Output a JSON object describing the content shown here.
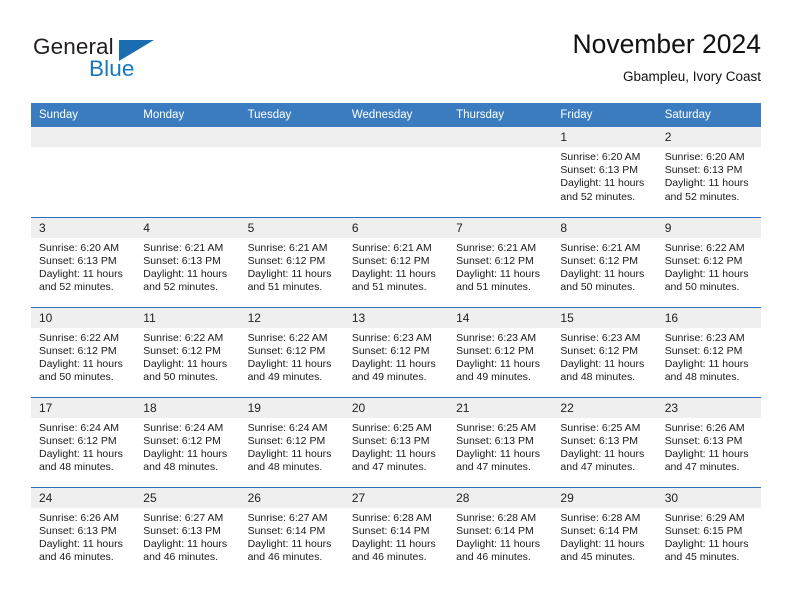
{
  "brand": {
    "name_part1": "General",
    "name_part2": "Blue",
    "triangle_color": "#1b6cb0",
    "blue_text_color": "#1878be"
  },
  "header": {
    "title": "November 2024",
    "subtitle": "Gbampleu, Ivory Coast"
  },
  "theme": {
    "header_blue": "#3b7cc0",
    "row_divider_blue": "#2f6fb5",
    "daynum_gray": "#efefef"
  },
  "weekday_headers": [
    "Sunday",
    "Monday",
    "Tuesday",
    "Wednesday",
    "Thursday",
    "Friday",
    "Saturday"
  ],
  "weeks": [
    [
      {
        "day": "",
        "lines": []
      },
      {
        "day": "",
        "lines": []
      },
      {
        "day": "",
        "lines": []
      },
      {
        "day": "",
        "lines": []
      },
      {
        "day": "",
        "lines": []
      },
      {
        "day": "1",
        "lines": [
          "Sunrise: 6:20 AM",
          "Sunset: 6:13 PM",
          "Daylight: 11 hours and 52 minutes."
        ]
      },
      {
        "day": "2",
        "lines": [
          "Sunrise: 6:20 AM",
          "Sunset: 6:13 PM",
          "Daylight: 11 hours and 52 minutes."
        ]
      }
    ],
    [
      {
        "day": "3",
        "lines": [
          "Sunrise: 6:20 AM",
          "Sunset: 6:13 PM",
          "Daylight: 11 hours and 52 minutes."
        ]
      },
      {
        "day": "4",
        "lines": [
          "Sunrise: 6:21 AM",
          "Sunset: 6:13 PM",
          "Daylight: 11 hours and 52 minutes."
        ]
      },
      {
        "day": "5",
        "lines": [
          "Sunrise: 6:21 AM",
          "Sunset: 6:12 PM",
          "Daylight: 11 hours and 51 minutes."
        ]
      },
      {
        "day": "6",
        "lines": [
          "Sunrise: 6:21 AM",
          "Sunset: 6:12 PM",
          "Daylight: 11 hours and 51 minutes."
        ]
      },
      {
        "day": "7",
        "lines": [
          "Sunrise: 6:21 AM",
          "Sunset: 6:12 PM",
          "Daylight: 11 hours and 51 minutes."
        ]
      },
      {
        "day": "8",
        "lines": [
          "Sunrise: 6:21 AM",
          "Sunset: 6:12 PM",
          "Daylight: 11 hours and 50 minutes."
        ]
      },
      {
        "day": "9",
        "lines": [
          "Sunrise: 6:22 AM",
          "Sunset: 6:12 PM",
          "Daylight: 11 hours and 50 minutes."
        ]
      }
    ],
    [
      {
        "day": "10",
        "lines": [
          "Sunrise: 6:22 AM",
          "Sunset: 6:12 PM",
          "Daylight: 11 hours and 50 minutes."
        ]
      },
      {
        "day": "11",
        "lines": [
          "Sunrise: 6:22 AM",
          "Sunset: 6:12 PM",
          "Daylight: 11 hours and 50 minutes."
        ]
      },
      {
        "day": "12",
        "lines": [
          "Sunrise: 6:22 AM",
          "Sunset: 6:12 PM",
          "Daylight: 11 hours and 49 minutes."
        ]
      },
      {
        "day": "13",
        "lines": [
          "Sunrise: 6:23 AM",
          "Sunset: 6:12 PM",
          "Daylight: 11 hours and 49 minutes."
        ]
      },
      {
        "day": "14",
        "lines": [
          "Sunrise: 6:23 AM",
          "Sunset: 6:12 PM",
          "Daylight: 11 hours and 49 minutes."
        ]
      },
      {
        "day": "15",
        "lines": [
          "Sunrise: 6:23 AM",
          "Sunset: 6:12 PM",
          "Daylight: 11 hours and 48 minutes."
        ]
      },
      {
        "day": "16",
        "lines": [
          "Sunrise: 6:23 AM",
          "Sunset: 6:12 PM",
          "Daylight: 11 hours and 48 minutes."
        ]
      }
    ],
    [
      {
        "day": "17",
        "lines": [
          "Sunrise: 6:24 AM",
          "Sunset: 6:12 PM",
          "Daylight: 11 hours and 48 minutes."
        ]
      },
      {
        "day": "18",
        "lines": [
          "Sunrise: 6:24 AM",
          "Sunset: 6:12 PM",
          "Daylight: 11 hours and 48 minutes."
        ]
      },
      {
        "day": "19",
        "lines": [
          "Sunrise: 6:24 AM",
          "Sunset: 6:12 PM",
          "Daylight: 11 hours and 48 minutes."
        ]
      },
      {
        "day": "20",
        "lines": [
          "Sunrise: 6:25 AM",
          "Sunset: 6:13 PM",
          "Daylight: 11 hours and 47 minutes."
        ]
      },
      {
        "day": "21",
        "lines": [
          "Sunrise: 6:25 AM",
          "Sunset: 6:13 PM",
          "Daylight: 11 hours and 47 minutes."
        ]
      },
      {
        "day": "22",
        "lines": [
          "Sunrise: 6:25 AM",
          "Sunset: 6:13 PM",
          "Daylight: 11 hours and 47 minutes."
        ]
      },
      {
        "day": "23",
        "lines": [
          "Sunrise: 6:26 AM",
          "Sunset: 6:13 PM",
          "Daylight: 11 hours and 47 minutes."
        ]
      }
    ],
    [
      {
        "day": "24",
        "lines": [
          "Sunrise: 6:26 AM",
          "Sunset: 6:13 PM",
          "Daylight: 11 hours and 46 minutes."
        ]
      },
      {
        "day": "25",
        "lines": [
          "Sunrise: 6:27 AM",
          "Sunset: 6:13 PM",
          "Daylight: 11 hours and 46 minutes."
        ]
      },
      {
        "day": "26",
        "lines": [
          "Sunrise: 6:27 AM",
          "Sunset: 6:14 PM",
          "Daylight: 11 hours and 46 minutes."
        ]
      },
      {
        "day": "27",
        "lines": [
          "Sunrise: 6:28 AM",
          "Sunset: 6:14 PM",
          "Daylight: 11 hours and 46 minutes."
        ]
      },
      {
        "day": "28",
        "lines": [
          "Sunrise: 6:28 AM",
          "Sunset: 6:14 PM",
          "Daylight: 11 hours and 46 minutes."
        ]
      },
      {
        "day": "29",
        "lines": [
          "Sunrise: 6:28 AM",
          "Sunset: 6:14 PM",
          "Daylight: 11 hours and 45 minutes."
        ]
      },
      {
        "day": "30",
        "lines": [
          "Sunrise: 6:29 AM",
          "Sunset: 6:15 PM",
          "Daylight: 11 hours and 45 minutes."
        ]
      }
    ]
  ]
}
